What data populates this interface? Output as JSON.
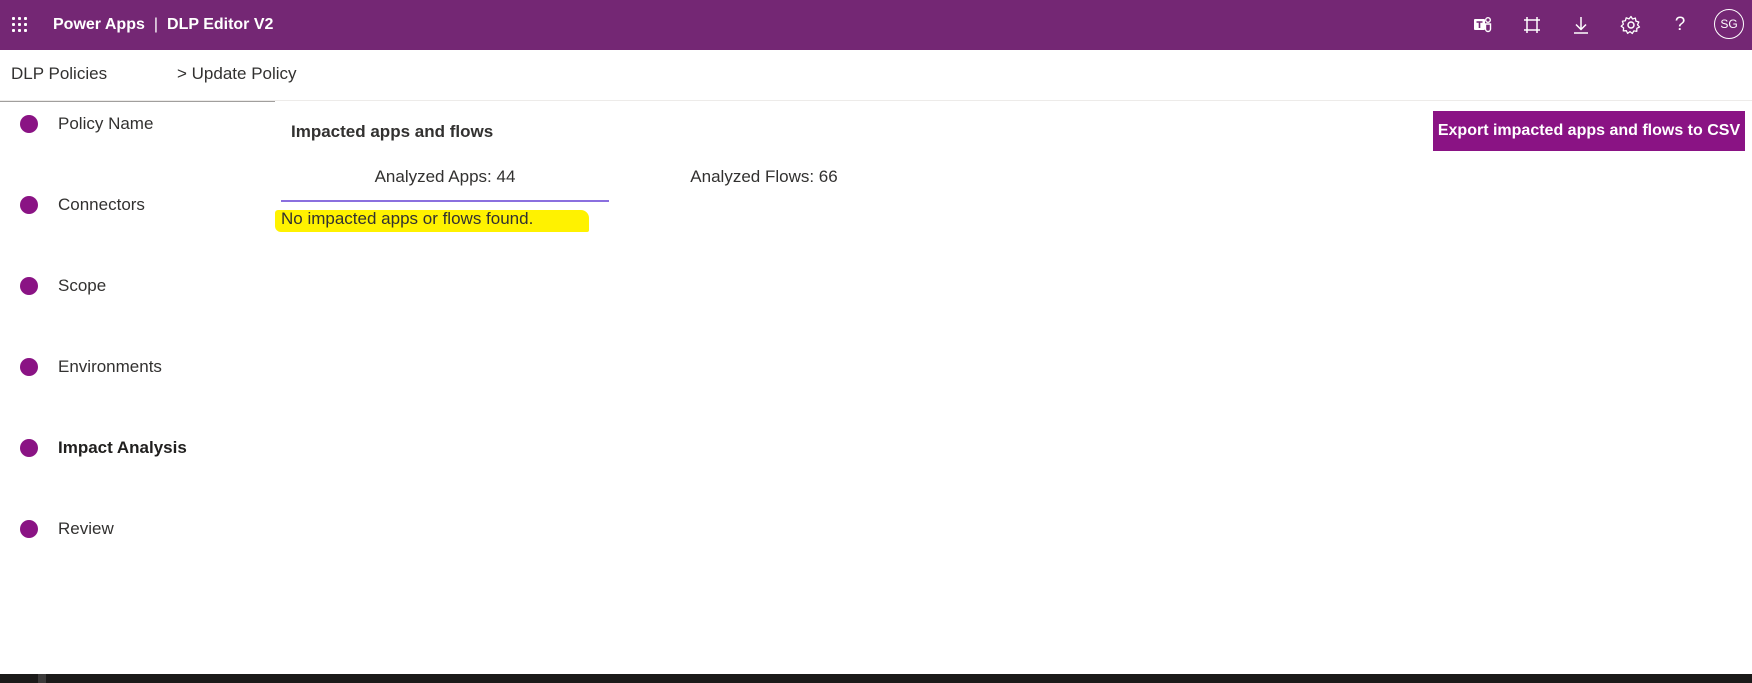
{
  "header": {
    "app_name": "Power Apps",
    "separator": "|",
    "page_name": "DLP Editor V2",
    "icons": [
      "waffle-icon",
      "teams-icon",
      "fullscreen-icon",
      "download-icon",
      "settings-gear-icon",
      "help-icon"
    ],
    "help_glyph": "?",
    "user_initials": "SG",
    "colors": {
      "bar": "#742774",
      "text": "#ffffff"
    }
  },
  "breadcrumb": {
    "root": "DLP Policies",
    "current": "> Update Policy"
  },
  "steps": {
    "items": [
      {
        "label": "Policy Name",
        "active": false
      },
      {
        "label": "Connectors",
        "active": false
      },
      {
        "label": "Scope",
        "active": false
      },
      {
        "label": "Environments",
        "active": false
      },
      {
        "label": "Impact Analysis",
        "active": true
      },
      {
        "label": "Review",
        "active": false
      }
    ],
    "dot_color": "#8a1384"
  },
  "main": {
    "section_title": "Impacted apps and flows",
    "export_button": "Export impacted apps and flows to CSV",
    "tabs": [
      {
        "label": "Analyzed Apps: 44",
        "selected": true
      },
      {
        "label": "Analyzed Flows: 66",
        "selected": false
      }
    ],
    "empty_message": "No impacted apps or flows found.",
    "highlight_color": "#fff200",
    "accent_color": "#8a1384"
  }
}
